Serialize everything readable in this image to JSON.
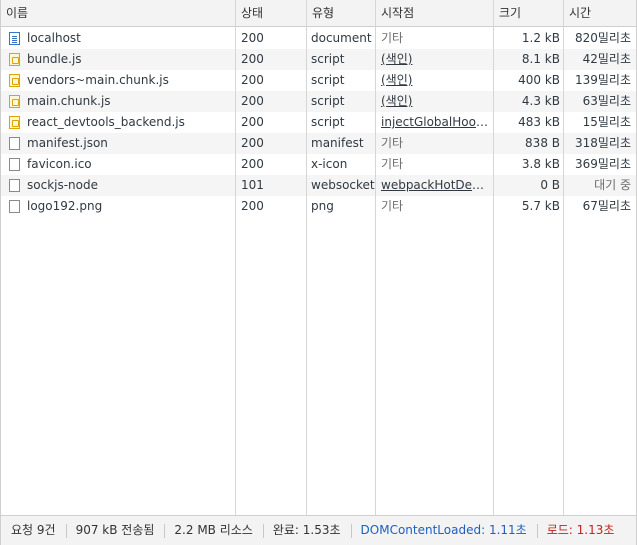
{
  "columns": {
    "name": "이름",
    "status": "상태",
    "type": "유형",
    "initiator": "시작점",
    "size": "크기",
    "time": "시간"
  },
  "requests": [
    {
      "name": "localhost",
      "icon": "document-icon",
      "status": "200",
      "type": "document",
      "initiator": "기타",
      "initiator_link": false,
      "size": "1.2 kB",
      "time": "820밀리초"
    },
    {
      "name": "bundle.js",
      "icon": "script-icon",
      "status": "200",
      "type": "script",
      "initiator": "(색인)",
      "initiator_link": true,
      "size": "8.1 kB",
      "time": "42밀리초"
    },
    {
      "name": "vendors~main.chunk.js",
      "icon": "script-icon",
      "status": "200",
      "type": "script",
      "initiator": "(색인)",
      "initiator_link": true,
      "size": "400 kB",
      "time": "139밀리초"
    },
    {
      "name": "main.chunk.js",
      "icon": "script-icon",
      "status": "200",
      "type": "script",
      "initiator": "(색인)",
      "initiator_link": true,
      "size": "4.3 kB",
      "time": "63밀리초"
    },
    {
      "name": "react_devtools_backend.js",
      "icon": "script-icon",
      "status": "200",
      "type": "script",
      "initiator": "injectGlobalHook.j...",
      "initiator_link": true,
      "size": "483 kB",
      "time": "15밀리초"
    },
    {
      "name": "manifest.json",
      "icon": "file-icon",
      "status": "200",
      "type": "manifest",
      "initiator": "기타",
      "initiator_link": false,
      "size": "838 B",
      "time": "318밀리초"
    },
    {
      "name": "favicon.ico",
      "icon": "file-icon",
      "status": "200",
      "type": "x-icon",
      "initiator": "기타",
      "initiator_link": false,
      "size": "3.8 kB",
      "time": "369밀리초"
    },
    {
      "name": "sockjs-node",
      "icon": "file-icon",
      "status": "101",
      "type": "websocket",
      "initiator": "webpackHotDevCl...",
      "initiator_link": true,
      "size": "0 B",
      "time": "대기 중"
    },
    {
      "name": "logo192.png",
      "icon": "file-icon",
      "status": "200",
      "type": "png",
      "initiator": "기타",
      "initiator_link": false,
      "size": "5.7 kB",
      "time": "67밀리초"
    }
  ],
  "summary": {
    "requests": "요청 9건",
    "transferred": "907 kB 전송됨",
    "resources": "2.2 MB 리소스",
    "finish": "완료: 1.53초",
    "dom_content_loaded": "DOMContentLoaded: 1.11초",
    "load": "로드: 1.13초"
  },
  "colors": {
    "dom_content_loaded": "#1a61c2",
    "load": "#c5221f",
    "header_bg": "#f3f3f3",
    "row_alt_bg": "#f5f5f5"
  }
}
